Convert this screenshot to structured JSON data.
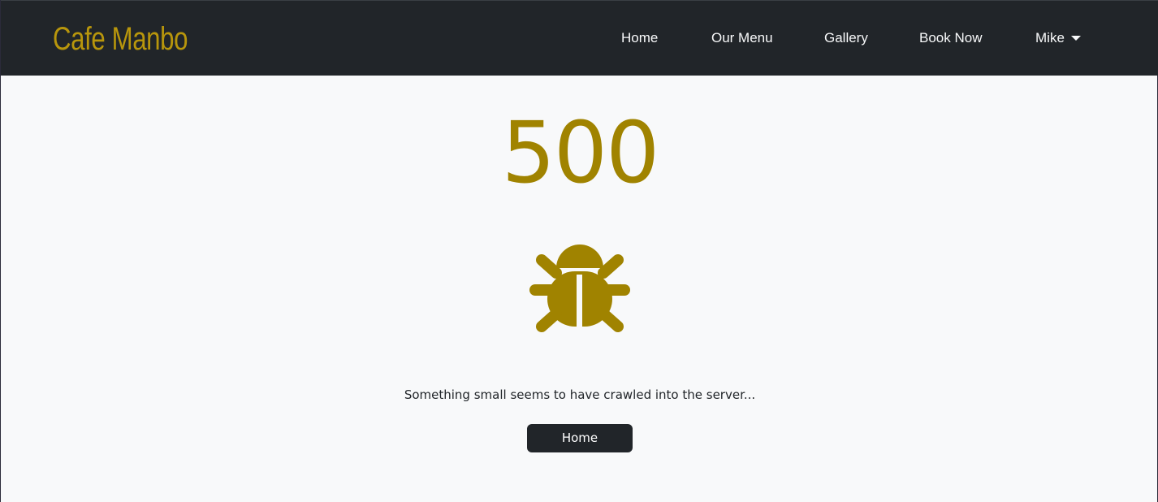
{
  "header": {
    "brand": "Cafe Manbo",
    "nav": {
      "home": "Home",
      "menu": "Our Menu",
      "gallery": "Gallery",
      "book": "Book Now",
      "user": "Mike"
    }
  },
  "error": {
    "code": "500",
    "icon": "bug-icon",
    "message": "Something small seems to have crawled into the server...",
    "button_label": "Home"
  },
  "colors": {
    "navbar": "#212529",
    "brand": "#b8960c",
    "accent": "#a08300",
    "background": "#f8f9fa",
    "button": "#212529"
  }
}
